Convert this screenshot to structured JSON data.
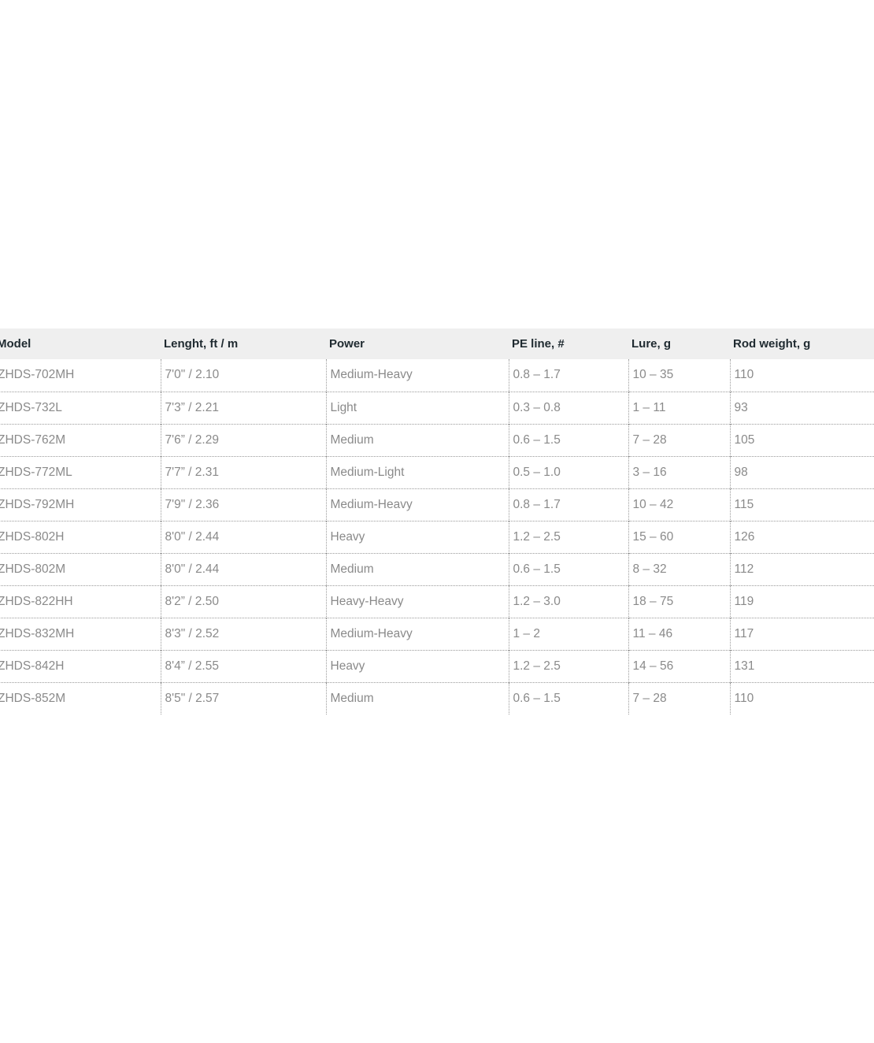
{
  "table": {
    "headers": [
      "Model",
      "Lenght, ft / m",
      "Power",
      "PE line, #",
      "Lure, g",
      "Rod weight, g"
    ],
    "rows": [
      [
        "ZHDS-702MH",
        "7'0\" / 2.10",
        "Medium-Heavy",
        "0.8 – 1.7",
        "10 – 35",
        "110"
      ],
      [
        "ZHDS-732L",
        "7'3” / 2.21",
        "Light",
        "0.3 – 0.8",
        "1 – 11",
        "93"
      ],
      [
        "ZHDS-762M",
        "7'6” / 2.29",
        "Medium",
        "0.6 – 1.5",
        "7 – 28",
        "105"
      ],
      [
        "ZHDS-772ML",
        "7'7” / 2.31",
        "Medium-Light",
        "0.5 – 1.0",
        "3 – 16",
        "98"
      ],
      [
        "ZHDS-792MH",
        "7'9\" / 2.36",
        "Medium-Heavy",
        "0.8 – 1.7",
        "10 – 42",
        "115"
      ],
      [
        "ZHDS-802H",
        "8'0\" / 2.44",
        "Heavy",
        "1.2 – 2.5",
        "15 – 60",
        "126"
      ],
      [
        "ZHDS-802M",
        "8'0\" / 2.44",
        "Medium",
        "0.6 – 1.5",
        "8 – 32",
        "112"
      ],
      [
        "ZHDS-822HH",
        "8'2” / 2.50",
        "Heavy-Heavy",
        "1.2 – 3.0",
        "18 – 75",
        "119"
      ],
      [
        "ZHDS-832MH",
        "8'3\" / 2.52",
        "Medium-Heavy",
        "1 – 2",
        "11 – 46",
        "117"
      ],
      [
        "ZHDS-842H",
        "8'4” / 2.55",
        "Heavy",
        "1.2 – 2.5",
        "14 – 56",
        "131"
      ],
      [
        "ZHDS-852M",
        "8'5\" / 2.57",
        "Medium",
        "0.6 – 1.5",
        "7 – 28",
        "110"
      ]
    ]
  }
}
